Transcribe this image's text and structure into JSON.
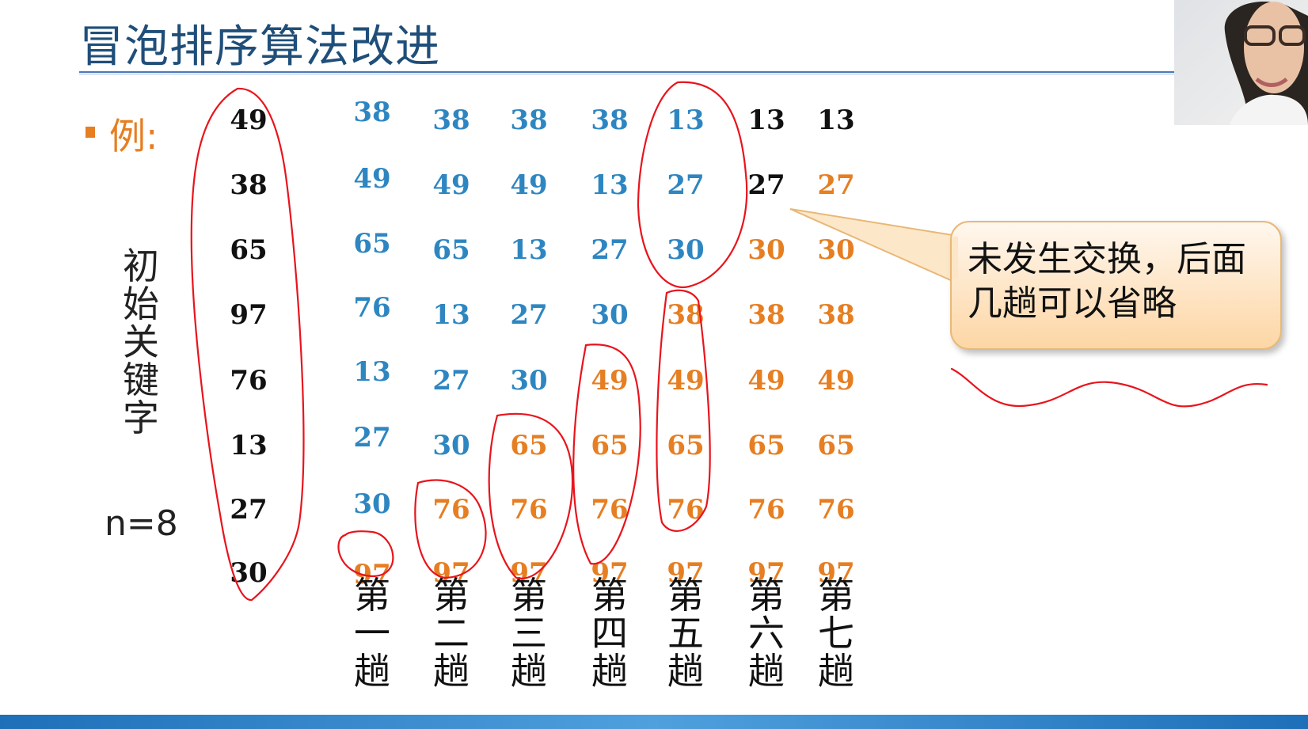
{
  "title": "冒泡排序算法改进",
  "example_label": "例:",
  "initial_keys_label": "初始关键字",
  "n_label": "n=8",
  "callout_text": "未发生交换，后面几趟可以省略",
  "colors": {
    "title": "#1f4e79",
    "black": "#111111",
    "blue": "#2e86c1",
    "orange": "#e67e22",
    "annotation_red": "#e8141c"
  },
  "columns": [
    {
      "label": "",
      "values": [
        "49",
        "38",
        "65",
        "97",
        "76",
        "13",
        "27",
        "30"
      ],
      "colors": [
        "black",
        "black",
        "black",
        "black",
        "black",
        "black",
        "black",
        "black"
      ]
    },
    {
      "label": "第一趟",
      "values": [
        "38",
        "49",
        "65",
        "76",
        "13",
        "27",
        "30",
        "97"
      ],
      "colors": [
        "blue",
        "blue",
        "blue",
        "blue",
        "blue",
        "blue",
        "blue",
        "orange"
      ]
    },
    {
      "label": "第二趟",
      "values": [
        "38",
        "49",
        "65",
        "13",
        "27",
        "30",
        "76",
        "97"
      ],
      "colors": [
        "blue",
        "blue",
        "blue",
        "blue",
        "blue",
        "blue",
        "orange",
        "orange"
      ]
    },
    {
      "label": "第三趟",
      "values": [
        "38",
        "49",
        "13",
        "27",
        "30",
        "65",
        "76",
        "97"
      ],
      "colors": [
        "blue",
        "blue",
        "blue",
        "blue",
        "blue",
        "orange",
        "orange",
        "orange"
      ]
    },
    {
      "label": "第四趟",
      "values": [
        "38",
        "13",
        "27",
        "30",
        "49",
        "65",
        "76",
        "97"
      ],
      "colors": [
        "blue",
        "blue",
        "blue",
        "blue",
        "orange",
        "orange",
        "orange",
        "orange"
      ]
    },
    {
      "label": "第五趟",
      "values": [
        "13",
        "27",
        "30",
        "38",
        "49",
        "65",
        "76",
        "97"
      ],
      "colors": [
        "blue",
        "blue",
        "blue",
        "orange",
        "orange",
        "orange",
        "orange",
        "orange"
      ]
    },
    {
      "label": "第六趟",
      "values": [
        "13",
        "27",
        "30",
        "38",
        "49",
        "65",
        "76",
        "97"
      ],
      "colors": [
        "black",
        "black",
        "orange",
        "orange",
        "orange",
        "orange",
        "orange",
        "orange"
      ]
    },
    {
      "label": "第七趟",
      "values": [
        "13",
        "27",
        "30",
        "38",
        "49",
        "65",
        "76",
        "97"
      ],
      "colors": [
        "black",
        "orange",
        "orange",
        "orange",
        "orange",
        "orange",
        "orange",
        "orange"
      ]
    }
  ],
  "icons": {
    "webcam": "presenter-webcam-thumbnail"
  }
}
